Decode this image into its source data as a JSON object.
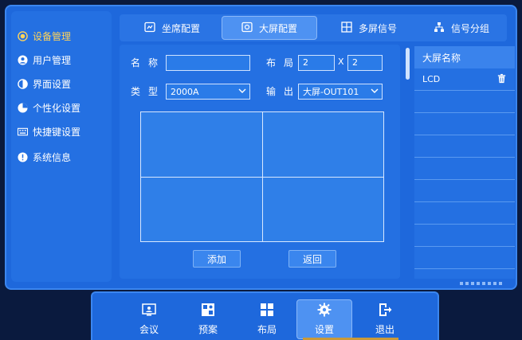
{
  "sidebar": {
    "items": [
      {
        "label": "设备管理",
        "icon": "radio-icon",
        "active": true
      },
      {
        "label": "用户管理",
        "icon": "user-icon"
      },
      {
        "label": "界面设置",
        "icon": "contrast-icon"
      },
      {
        "label": "个性化设置",
        "icon": "pie-icon"
      },
      {
        "label": "快捷键设置",
        "icon": "keyboard-icon"
      },
      {
        "label": "系统信息",
        "icon": "info-icon"
      }
    ]
  },
  "tabs": [
    {
      "label": "坐席配置",
      "icon": "seat-icon"
    },
    {
      "label": "大屏配置",
      "icon": "screen-icon",
      "active": true
    },
    {
      "label": "多屏信号",
      "icon": "multiscreen-icon"
    },
    {
      "label": "信号分组",
      "icon": "group-icon"
    }
  ],
  "form": {
    "name_label": "名称",
    "name_value": "",
    "layout_label": "布局",
    "layout_rows": "2",
    "layout_x": "X",
    "layout_cols": "2",
    "type_label": "类型",
    "type_value": "2000A",
    "output_label": "输出",
    "output_value": "大屏-OUT101"
  },
  "buttons": {
    "add": "添加",
    "back": "返回"
  },
  "screen_list": {
    "header": "大屏名称",
    "rows": [
      {
        "name": "LCD"
      }
    ]
  },
  "dock": {
    "items": [
      {
        "label": "会议",
        "icon": "meeting-icon"
      },
      {
        "label": "预案",
        "icon": "plan-icon"
      },
      {
        "label": "布局",
        "icon": "layout-icon"
      },
      {
        "label": "设置",
        "icon": "settings-icon",
        "active": true
      },
      {
        "label": "退出",
        "icon": "exit-icon"
      }
    ]
  },
  "colors": {
    "accent_active": "#ffd35a",
    "panel": "#2470e2",
    "background": "#1e68dc"
  }
}
